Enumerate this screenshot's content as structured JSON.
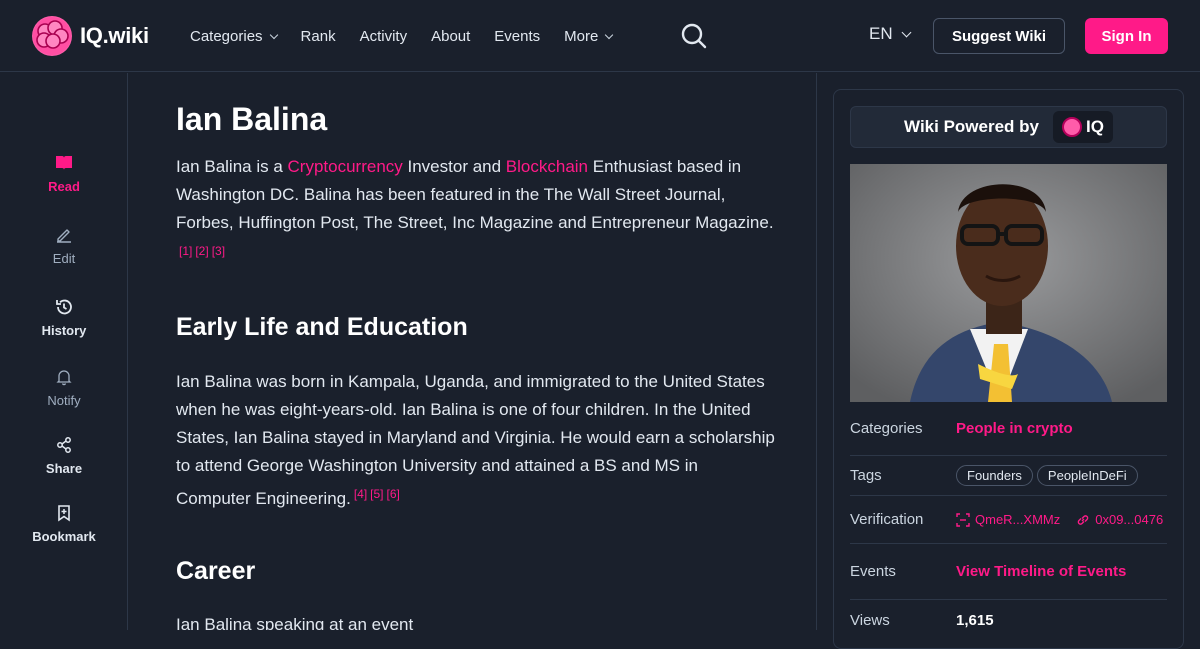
{
  "header": {
    "logo_text": "IQ.wiki",
    "nav": [
      {
        "label": "Categories",
        "has_dropdown": true
      },
      {
        "label": "Rank",
        "has_dropdown": false
      },
      {
        "label": "Activity",
        "has_dropdown": false
      },
      {
        "label": "About",
        "has_dropdown": false
      },
      {
        "label": "Events",
        "has_dropdown": false
      },
      {
        "label": "More",
        "has_dropdown": true
      }
    ],
    "language": "EN",
    "suggest_label": "Suggest Wiki",
    "signin_label": "Sign In",
    "icons": {
      "search": "search-icon",
      "language": "chevron-down-icon"
    }
  },
  "rail": [
    {
      "label": "Read",
      "icon": "book-icon",
      "state": "active"
    },
    {
      "label": "Edit",
      "icon": "pencil-icon",
      "state": "muted"
    },
    {
      "label": "History",
      "icon": "history-icon",
      "state": "normal"
    },
    {
      "label": "Notify",
      "icon": "bell-icon",
      "state": "muted"
    },
    {
      "label": "Share",
      "icon": "share-icon",
      "state": "normal"
    },
    {
      "label": "Bookmark",
      "icon": "bookmark-icon",
      "state": "normal"
    }
  ],
  "article": {
    "title": "Ian Balina",
    "intro": {
      "pre": "Ian Balina is a ",
      "link1": "Cryptocurrency",
      "mid": " Investor and ",
      "link2": "Blockchain",
      "post": " Enthusiast based in Washington DC. Balina has been featured in the The Wall Street Journal, Forbes, Huffington Post, The Street, Inc Magazine and Entrepreneur Magazine.",
      "citations": [
        "[1]",
        "[2]",
        "[3]"
      ]
    },
    "section1": {
      "heading": "Early Life and Education",
      "text": "Ian Balina was born in Kampala, Uganda, and immigrated to the United States when he was eight-years-old. Ian Balina is one of four children. In the United States, Ian Balina stayed in Maryland and Virginia. He would earn a scholarship to attend George Washington University and attained a BS and MS in Computer Engineering.",
      "citations": [
        "[4]",
        "[5]",
        "[6]"
      ]
    },
    "section2": {
      "heading": "Career",
      "text": "Ian Balina speaking at an event"
    }
  },
  "sidebar": {
    "powered_label": "Wiki Powered by",
    "iq_label": "IQ",
    "categories_key": "Categories",
    "categories_value": "People in crypto",
    "tags_key": "Tags",
    "tags": [
      "Founders",
      "PeopleInDeFi"
    ],
    "verification_key": "Verification",
    "ipfs_hash": "QmeR...XMMz",
    "tx_hash": "0x09...0476",
    "events_key": "Events",
    "events_value": "View Timeline of Events",
    "views_key": "Views",
    "views_value": "1,615"
  },
  "colors": {
    "accent": "#ff1a88",
    "background": "#1a202c",
    "border": "#2d3748"
  }
}
